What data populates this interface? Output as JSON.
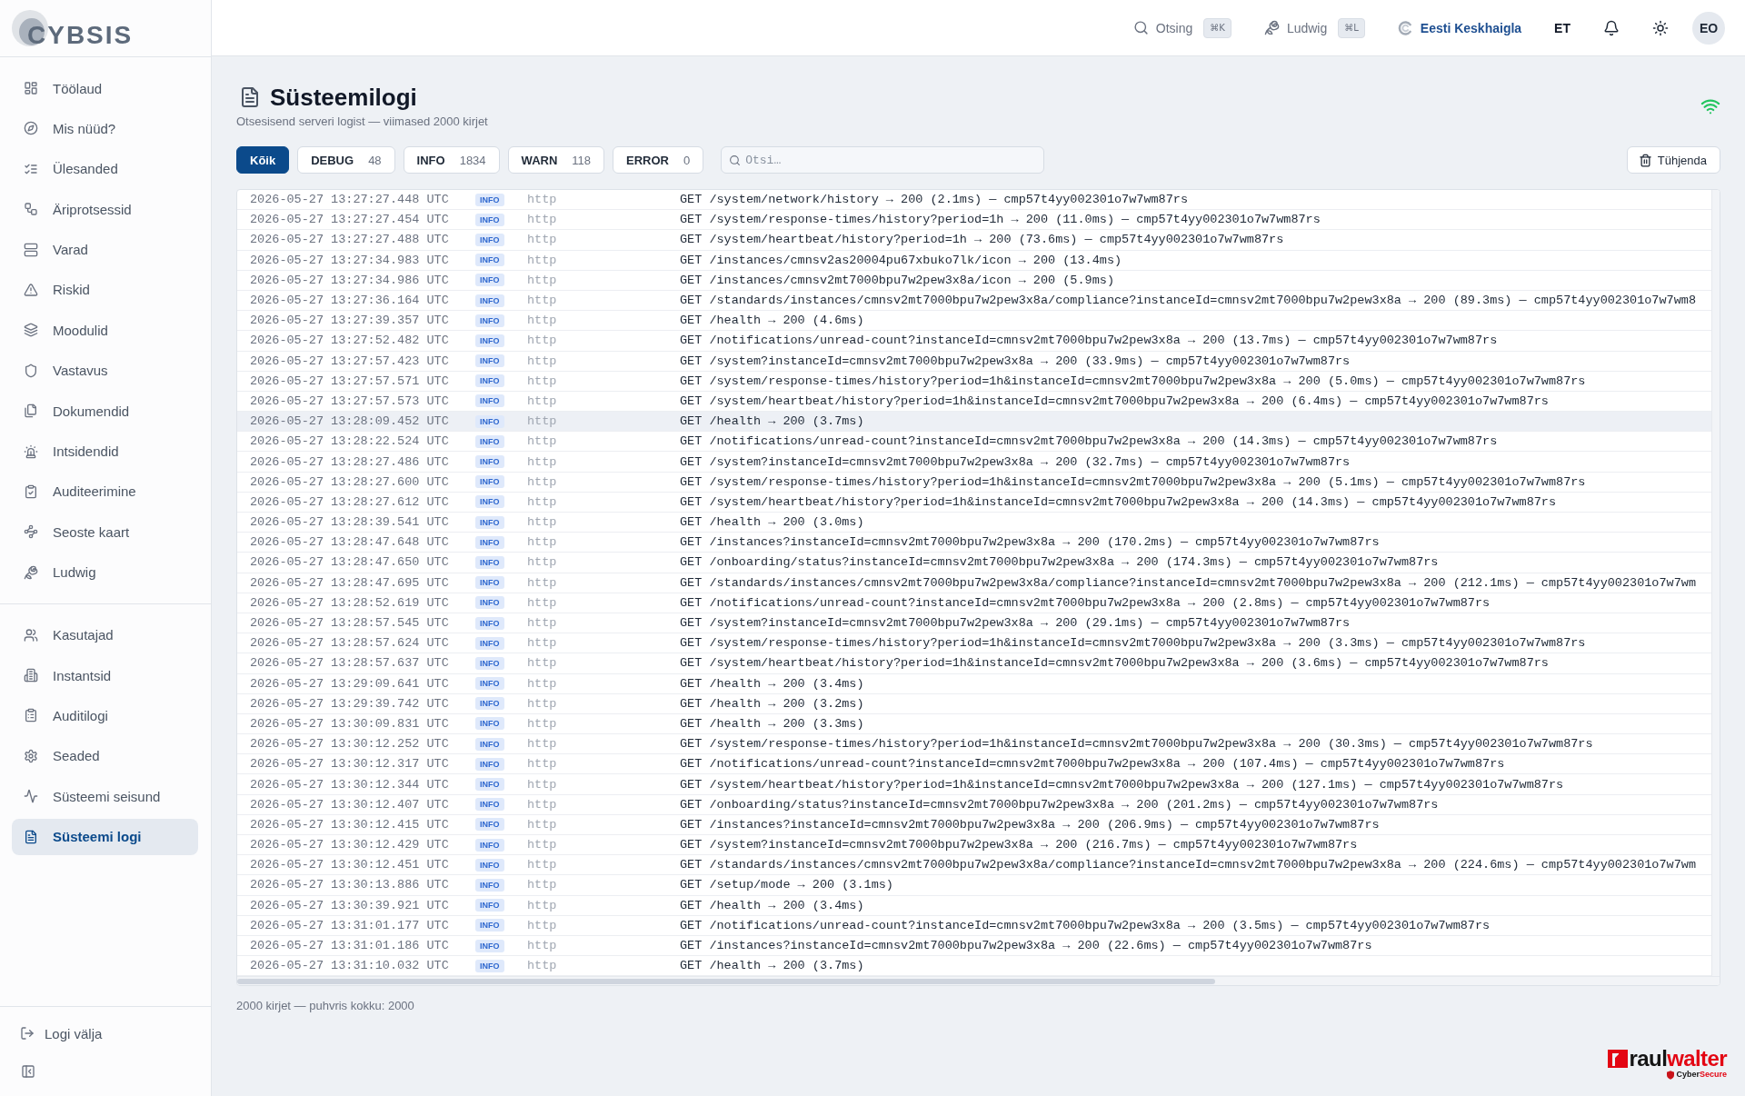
{
  "sidebar": {
    "logo": "CYBSIS",
    "groups": [
      {
        "items": [
          {
            "label": "Töölaud",
            "selected": false
          },
          {
            "label": "Mis nüüd?",
            "selected": false
          },
          {
            "label": "Ülesanded",
            "selected": false
          },
          {
            "label": "Äriprotsessid",
            "selected": false
          },
          {
            "label": "Varad",
            "selected": false
          },
          {
            "label": "Riskid",
            "selected": false
          },
          {
            "label": "Moodulid",
            "selected": false
          },
          {
            "label": "Vastavus",
            "selected": false
          },
          {
            "label": "Dokumendid",
            "selected": false
          },
          {
            "label": "Intsidendid",
            "selected": false
          },
          {
            "label": "Auditeerimine",
            "selected": false
          },
          {
            "label": "Seoste kaart",
            "selected": false
          },
          {
            "label": "Ludwig",
            "selected": false
          }
        ]
      },
      {
        "items": [
          {
            "label": "Kasutajad",
            "selected": false
          },
          {
            "label": "Instantsid",
            "selected": false
          },
          {
            "label": "Auditilogi",
            "selected": false
          },
          {
            "label": "Seaded",
            "selected": false
          },
          {
            "label": "Süsteemi seisund",
            "selected": false
          },
          {
            "label": "Süsteemi logi",
            "selected": true
          }
        ]
      }
    ],
    "logout": "Logi välja"
  },
  "topbar": {
    "search": {
      "label": "Otsing",
      "shortcut": "⌘K"
    },
    "assistant": {
      "label": "Ludwig",
      "shortcut": "⌘L"
    },
    "organization": "Eesti Keskhaigla",
    "language": "ET",
    "avatar": "EO"
  },
  "page": {
    "title": "Süsteemilogi",
    "subtitle": "Otsesisend serveri logist — viimased 2000 kirjet"
  },
  "filters": [
    {
      "label": "Kõik",
      "selected": true
    },
    {
      "label": "DEBUG",
      "count": "48",
      "selected": false
    },
    {
      "label": "INFO",
      "count": "1834",
      "selected": false
    },
    {
      "label": "WARN",
      "count": "118",
      "selected": false
    },
    {
      "label": "ERROR",
      "count": "0",
      "selected": false
    }
  ],
  "log_search": {
    "placeholder": "Otsi…"
  },
  "clear_button": "Tühjenda",
  "log_rows": [
    {
      "time": "2026-05-27 13:27:27.448 UTC",
      "level": "INFO",
      "source": "http",
      "message": "GET /system/network/history → 200 (2.1ms) — cmp57t4yy002301o7w7wm87rs",
      "highlighted": false
    },
    {
      "time": "2026-05-27 13:27:27.454 UTC",
      "level": "INFO",
      "source": "http",
      "message": "GET /system/response-times/history?period=1h → 200 (11.0ms) — cmp57t4yy002301o7w7wm87rs",
      "highlighted": false
    },
    {
      "time": "2026-05-27 13:27:27.488 UTC",
      "level": "INFO",
      "source": "http",
      "message": "GET /system/heartbeat/history?period=1h → 200 (73.6ms) — cmp57t4yy002301o7w7wm87rs",
      "highlighted": false
    },
    {
      "time": "2026-05-27 13:27:34.983 UTC",
      "level": "INFO",
      "source": "http",
      "message": "GET /instances/cmnsv2as20004pu67xbuko7lk/icon → 200 (13.4ms)",
      "highlighted": false
    },
    {
      "time": "2026-05-27 13:27:34.986 UTC",
      "level": "INFO",
      "source": "http",
      "message": "GET /instances/cmnsv2mt7000bpu7w2pew3x8a/icon → 200 (5.9ms)",
      "highlighted": false
    },
    {
      "time": "2026-05-27 13:27:36.164 UTC",
      "level": "INFO",
      "source": "http",
      "message": "GET /standards/instances/cmnsv2mt7000bpu7w2pew3x8a/compliance?instanceId=cmnsv2mt7000bpu7w2pew3x8a → 200 (89.3ms) — cmp57t4yy002301o7w7wm8",
      "highlighted": false
    },
    {
      "time": "2026-05-27 13:27:39.357 UTC",
      "level": "INFO",
      "source": "http",
      "message": "GET /health → 200 (4.6ms)",
      "highlighted": false
    },
    {
      "time": "2026-05-27 13:27:52.482 UTC",
      "level": "INFO",
      "source": "http",
      "message": "GET /notifications/unread-count?instanceId=cmnsv2mt7000bpu7w2pew3x8a → 200 (13.7ms) — cmp57t4yy002301o7w7wm87rs",
      "highlighted": false
    },
    {
      "time": "2026-05-27 13:27:57.423 UTC",
      "level": "INFO",
      "source": "http",
      "message": "GET /system?instanceId=cmnsv2mt7000bpu7w2pew3x8a → 200 (33.9ms) — cmp57t4yy002301o7w7wm87rs",
      "highlighted": false
    },
    {
      "time": "2026-05-27 13:27:57.571 UTC",
      "level": "INFO",
      "source": "http",
      "message": "GET /system/response-times/history?period=1h&instanceId=cmnsv2mt7000bpu7w2pew3x8a → 200 (5.0ms) — cmp57t4yy002301o7w7wm87rs",
      "highlighted": false
    },
    {
      "time": "2026-05-27 13:27:57.573 UTC",
      "level": "INFO",
      "source": "http",
      "message": "GET /system/heartbeat/history?period=1h&instanceId=cmnsv2mt7000bpu7w2pew3x8a → 200 (6.4ms) — cmp57t4yy002301o7w7wm87rs",
      "highlighted": false
    },
    {
      "time": "2026-05-27 13:28:09.452 UTC",
      "level": "INFO",
      "source": "http",
      "message": "GET /health → 200 (3.7ms)",
      "highlighted": true
    },
    {
      "time": "2026-05-27 13:28:22.524 UTC",
      "level": "INFO",
      "source": "http",
      "message": "GET /notifications/unread-count?instanceId=cmnsv2mt7000bpu7w2pew3x8a → 200 (14.3ms) — cmp57t4yy002301o7w7wm87rs",
      "highlighted": false
    },
    {
      "time": "2026-05-27 13:28:27.486 UTC",
      "level": "INFO",
      "source": "http",
      "message": "GET /system?instanceId=cmnsv2mt7000bpu7w2pew3x8a → 200 (32.7ms) — cmp57t4yy002301o7w7wm87rs",
      "highlighted": false
    },
    {
      "time": "2026-05-27 13:28:27.600 UTC",
      "level": "INFO",
      "source": "http",
      "message": "GET /system/response-times/history?period=1h&instanceId=cmnsv2mt7000bpu7w2pew3x8a → 200 (5.1ms) — cmp57t4yy002301o7w7wm87rs",
      "highlighted": false
    },
    {
      "time": "2026-05-27 13:28:27.612 UTC",
      "level": "INFO",
      "source": "http",
      "message": "GET /system/heartbeat/history?period=1h&instanceId=cmnsv2mt7000bpu7w2pew3x8a → 200 (14.3ms) — cmp57t4yy002301o7w7wm87rs",
      "highlighted": false
    },
    {
      "time": "2026-05-27 13:28:39.541 UTC",
      "level": "INFO",
      "source": "http",
      "message": "GET /health → 200 (3.0ms)",
      "highlighted": false
    },
    {
      "time": "2026-05-27 13:28:47.648 UTC",
      "level": "INFO",
      "source": "http",
      "message": "GET /instances?instanceId=cmnsv2mt7000bpu7w2pew3x8a → 200 (170.2ms) — cmp57t4yy002301o7w7wm87rs",
      "highlighted": false
    },
    {
      "time": "2026-05-27 13:28:47.650 UTC",
      "level": "INFO",
      "source": "http",
      "message": "GET /onboarding/status?instanceId=cmnsv2mt7000bpu7w2pew3x8a → 200 (174.3ms) — cmp57t4yy002301o7w7wm87rs",
      "highlighted": false
    },
    {
      "time": "2026-05-27 13:28:47.695 UTC",
      "level": "INFO",
      "source": "http",
      "message": "GET /standards/instances/cmnsv2mt7000bpu7w2pew3x8a/compliance?instanceId=cmnsv2mt7000bpu7w2pew3x8a → 200 (212.1ms) — cmp57t4yy002301o7w7wm",
      "highlighted": false
    },
    {
      "time": "2026-05-27 13:28:52.619 UTC",
      "level": "INFO",
      "source": "http",
      "message": "GET /notifications/unread-count?instanceId=cmnsv2mt7000bpu7w2pew3x8a → 200 (2.8ms) — cmp57t4yy002301o7w7wm87rs",
      "highlighted": false
    },
    {
      "time": "2026-05-27 13:28:57.545 UTC",
      "level": "INFO",
      "source": "http",
      "message": "GET /system?instanceId=cmnsv2mt7000bpu7w2pew3x8a → 200 (29.1ms) — cmp57t4yy002301o7w7wm87rs",
      "highlighted": false
    },
    {
      "time": "2026-05-27 13:28:57.624 UTC",
      "level": "INFO",
      "source": "http",
      "message": "GET /system/response-times/history?period=1h&instanceId=cmnsv2mt7000bpu7w2pew3x8a → 200 (3.3ms) — cmp57t4yy002301o7w7wm87rs",
      "highlighted": false
    },
    {
      "time": "2026-05-27 13:28:57.637 UTC",
      "level": "INFO",
      "source": "http",
      "message": "GET /system/heartbeat/history?period=1h&instanceId=cmnsv2mt7000bpu7w2pew3x8a → 200 (3.6ms) — cmp57t4yy002301o7w7wm87rs",
      "highlighted": false
    },
    {
      "time": "2026-05-27 13:29:09.641 UTC",
      "level": "INFO",
      "source": "http",
      "message": "GET /health → 200 (3.4ms)",
      "highlighted": false
    },
    {
      "time": "2026-05-27 13:29:39.742 UTC",
      "level": "INFO",
      "source": "http",
      "message": "GET /health → 200 (3.2ms)",
      "highlighted": false
    },
    {
      "time": "2026-05-27 13:30:09.831 UTC",
      "level": "INFO",
      "source": "http",
      "message": "GET /health → 200 (3.3ms)",
      "highlighted": false
    },
    {
      "time": "2026-05-27 13:30:12.252 UTC",
      "level": "INFO",
      "source": "http",
      "message": "GET /system/response-times/history?period=1h&instanceId=cmnsv2mt7000bpu7w2pew3x8a → 200 (30.3ms) — cmp57t4yy002301o7w7wm87rs",
      "highlighted": false
    },
    {
      "time": "2026-05-27 13:30:12.317 UTC",
      "level": "INFO",
      "source": "http",
      "message": "GET /notifications/unread-count?instanceId=cmnsv2mt7000bpu7w2pew3x8a → 200 (107.4ms) — cmp57t4yy002301o7w7wm87rs",
      "highlighted": false
    },
    {
      "time": "2026-05-27 13:30:12.344 UTC",
      "level": "INFO",
      "source": "http",
      "message": "GET /system/heartbeat/history?period=1h&instanceId=cmnsv2mt7000bpu7w2pew3x8a → 200 (127.1ms) — cmp57t4yy002301o7w7wm87rs",
      "highlighted": false
    },
    {
      "time": "2026-05-27 13:30:12.407 UTC",
      "level": "INFO",
      "source": "http",
      "message": "GET /onboarding/status?instanceId=cmnsv2mt7000bpu7w2pew3x8a → 200 (201.2ms) — cmp57t4yy002301o7w7wm87rs",
      "highlighted": false
    },
    {
      "time": "2026-05-27 13:30:12.415 UTC",
      "level": "INFO",
      "source": "http",
      "message": "GET /instances?instanceId=cmnsv2mt7000bpu7w2pew3x8a → 200 (206.9ms) — cmp57t4yy002301o7w7wm87rs",
      "highlighted": false
    },
    {
      "time": "2026-05-27 13:30:12.429 UTC",
      "level": "INFO",
      "source": "http",
      "message": "GET /system?instanceId=cmnsv2mt7000bpu7w2pew3x8a → 200 (216.7ms) — cmp57t4yy002301o7w7wm87rs",
      "highlighted": false
    },
    {
      "time": "2026-05-27 13:30:12.451 UTC",
      "level": "INFO",
      "source": "http",
      "message": "GET /standards/instances/cmnsv2mt7000bpu7w2pew3x8a/compliance?instanceId=cmnsv2mt7000bpu7w2pew3x8a → 200 (224.6ms) — cmp57t4yy002301o7w7wm",
      "highlighted": false
    },
    {
      "time": "2026-05-27 13:30:13.886 UTC",
      "level": "INFO",
      "source": "http",
      "message": "GET /setup/mode → 200 (3.1ms)",
      "highlighted": false
    },
    {
      "time": "2026-05-27 13:30:39.921 UTC",
      "level": "INFO",
      "source": "http",
      "message": "GET /health → 200 (3.4ms)",
      "highlighted": false
    },
    {
      "time": "2026-05-27 13:31:01.177 UTC",
      "level": "INFO",
      "source": "http",
      "message": "GET /notifications/unread-count?instanceId=cmnsv2mt7000bpu7w2pew3x8a → 200 (3.5ms) — cmp57t4yy002301o7w7wm87rs",
      "highlighted": false
    },
    {
      "time": "2026-05-27 13:31:01.186 UTC",
      "level": "INFO",
      "source": "http",
      "message": "GET /instances?instanceId=cmnsv2mt7000bpu7w2pew3x8a → 200 (22.6ms) — cmp57t4yy002301o7w7wm87rs",
      "highlighted": false
    },
    {
      "time": "2026-05-27 13:31:10.032 UTC",
      "level": "INFO",
      "source": "http",
      "message": "GET /health → 200 (3.7ms)",
      "highlighted": false
    }
  ],
  "footer": "2000 kirjet — puhvris kokku: 2000",
  "brand": {
    "name_parts": [
      "raul",
      "walter"
    ],
    "tagline_parts": [
      "Cyber",
      "Secure"
    ]
  }
}
